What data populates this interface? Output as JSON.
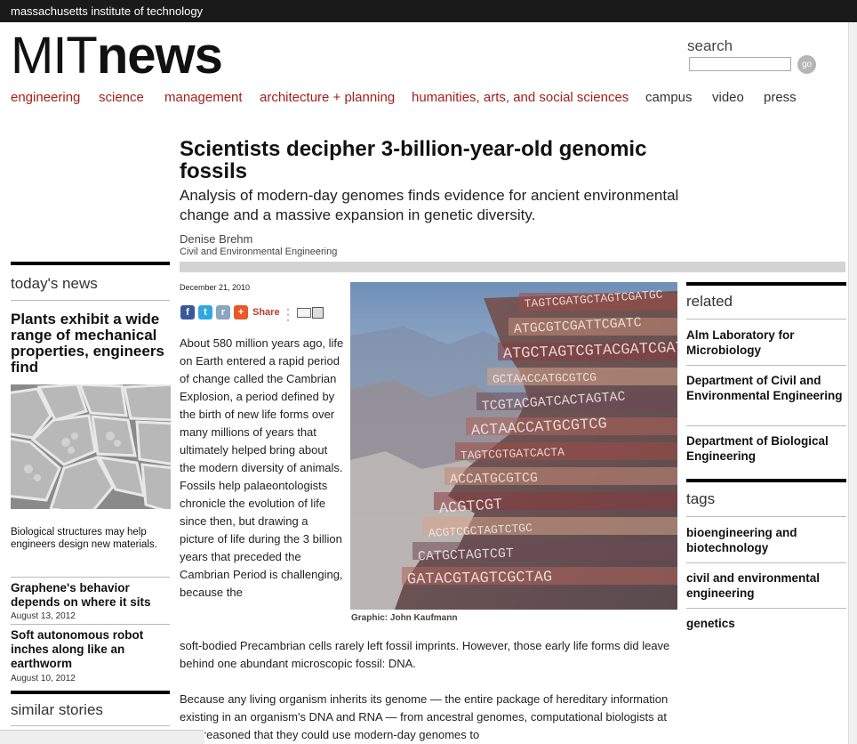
{
  "header": {
    "institute": "massachusetts institute of technology",
    "logo_part1": "MIT",
    "logo_part2": "news",
    "search_label": "search",
    "search_value": "",
    "go_label": "go"
  },
  "nav": {
    "engineering": "engineering",
    "science": "science",
    "management": "management",
    "architecture": "architecture + planning",
    "humanities": "humanities, arts, and social sciences",
    "campus": "campus",
    "video": "video",
    "press": "press"
  },
  "article": {
    "title": "Scientists decipher 3-billion-year-old genomic fossils",
    "dek": "Analysis of modern-day genomes finds evidence for ancient environmental change and a massive expansion in genetic diversity.",
    "author": "Denise Brehm",
    "department": "Civil and Environmental Engineering",
    "date": "December 21, 2010",
    "share_label": "Share",
    "para1_narrow": "About 580 million years ago, life on Earth entered a rapid period of change called the Cambrian Explosion, a period defined by the birth of new life forms over many millions of years that ultimately helped bring about the modern diversity of animals. Fossils help palaeontologists chronicle the evolution of life since then, but drawing a picture of life during the 3 billion years that preceded the Cambrian Period is challenging, because the",
    "para1_wide": "soft-bodied Precambrian cells rarely left fossil imprints. However, those early life forms did leave behind one abundant microscopic fossil: DNA.",
    "para2": "Because any living organism inherits its genome — the entire package of hereditary information existing in an organism's DNA and RNA — from ancestral genomes, computational biologists at MIT reasoned that they could use modern-day genomes to",
    "caption": "Graphic: John Kaufmann",
    "dna_strips": [
      "TAGTCGATGCTAGTCGATGC",
      "ATGCGTCGATTCGATC",
      "ATGCTAGTCGTACGATCGATCG",
      "GCTAACCATGCGTCG",
      "TCGTACGATCACTAGTAC",
      "ACTAACCATGCGTCG",
      "TAGTCGTGATCACTA",
      "ACCATGCGTCG",
      "ACGTCGT",
      "ACGTCGCTAGTCTGC",
      "CATGCTAGTCGT",
      "GATACGTAGTCGCTAG"
    ]
  },
  "left": {
    "section_title": "today's news",
    "feature_title": "Plants exhibit a wide range of mechanical properties, engineers find",
    "feature_desc": "Biological structures may help engineers design new materials.",
    "story1_title": "Graphene's behavior depends on where it sits",
    "story1_date": "August 13, 2012",
    "story2_title": "Soft autonomous robot inches along like an earthworm",
    "story2_date": "August 10, 2012",
    "similar_title": "similar stories"
  },
  "right": {
    "related_title": "related",
    "related_items": [
      "Alm Laboratory for Microbiology",
      "Department of Civil and Environmental Engineering",
      "Department of Biological Engineering"
    ],
    "tags_title": "tags",
    "tag_items": [
      "bioengineering and biotechnology",
      "civil and environmental engineering",
      "genetics"
    ]
  },
  "colors": {
    "nav_red": "#a31f1a",
    "topbar": "#1a1a1a",
    "share_red": "#c0392b"
  }
}
